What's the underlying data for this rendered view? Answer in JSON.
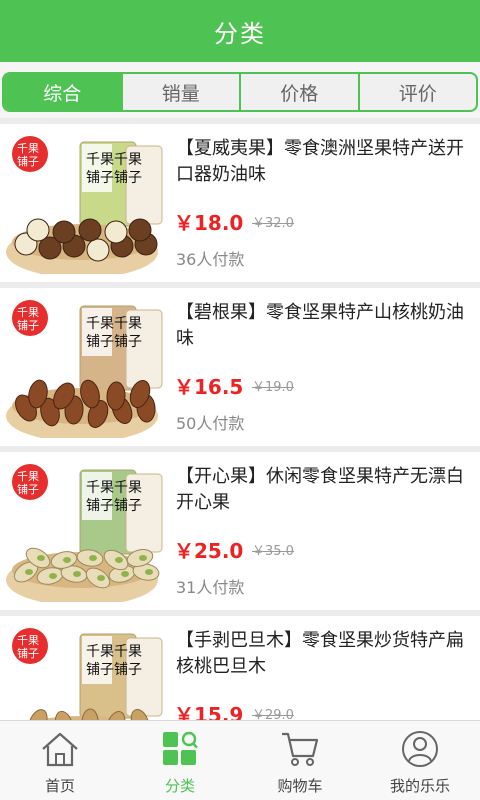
{
  "header": {
    "title": "分类"
  },
  "tabs": [
    {
      "label": "综合",
      "active": true
    },
    {
      "label": "销量",
      "active": false
    },
    {
      "label": "价格",
      "active": false
    },
    {
      "label": "评价",
      "active": false
    }
  ],
  "products": [
    {
      "title": "【夏威夷果】零食澳洲坚果特产送开口器奶油味",
      "price": "￥18.0",
      "original_price": "￥32.0",
      "sold": "36人付款",
      "nut": "macadamia",
      "pack_color": "#c9d98a"
    },
    {
      "title": "【碧根果】零食坚果特产山核桃奶油味",
      "price": "￥16.5",
      "original_price": "￥19.0",
      "sold": "50人付款",
      "nut": "pecan",
      "pack_color": "#d6b48a"
    },
    {
      "title": "【开心果】休闲零食坚果特产无漂白开心果",
      "price": "￥25.0",
      "original_price": "￥35.0",
      "sold": "31人付款",
      "nut": "pistachio",
      "pack_color": "#a8c98a"
    },
    {
      "title": "【手剥巴旦木】零食坚果炒货特产扁核桃巴旦木",
      "price": "￥15.9",
      "original_price": "￥29.0",
      "sold": "",
      "nut": "almond",
      "pack_color": "#d9c08a"
    }
  ],
  "bottom_nav": [
    {
      "label": "首页",
      "icon": "home-icon",
      "active": false
    },
    {
      "label": "分类",
      "icon": "category-icon",
      "active": true
    },
    {
      "label": "购物车",
      "icon": "cart-icon",
      "active": false
    },
    {
      "label": "我的乐乐",
      "icon": "user-icon",
      "active": false
    }
  ],
  "colors": {
    "accent": "#4fc254",
    "price": "#ee2222"
  }
}
